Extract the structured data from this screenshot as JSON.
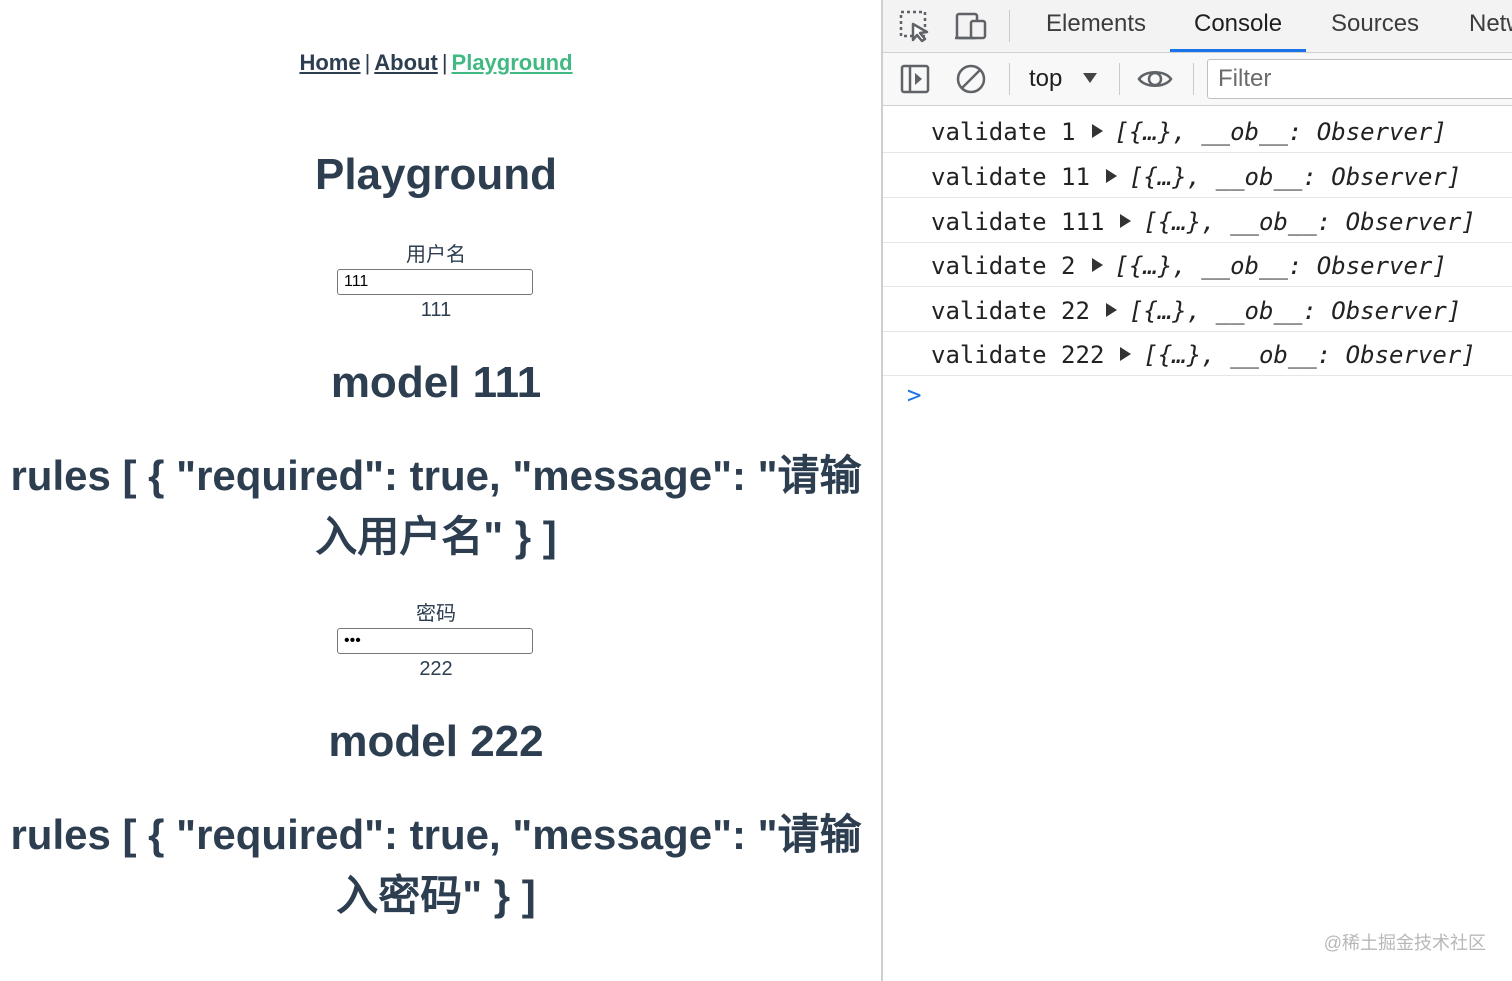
{
  "app": {
    "nav": [
      {
        "label": "Home"
      },
      {
        "label": "About"
      },
      {
        "label": "Playground"
      }
    ],
    "nav_separator": "|",
    "title": "Playground",
    "username": {
      "label": "用户名",
      "value": "111",
      "echo": "111",
      "model": "model 111",
      "rules": "rules [ { \"required\": true, \"message\": \"请输入用户名\" } ]"
    },
    "password": {
      "label": "密码",
      "value": "222",
      "echo": "222",
      "model": "model 222",
      "rules": "rules [ { \"required\": true, \"message\": \"请输入密码\" } ]"
    }
  },
  "devtools": {
    "tabs": [
      "Elements",
      "Console",
      "Sources",
      "Network"
    ],
    "active_tab": "Console",
    "context": "top",
    "filter_placeholder": "Filter",
    "logs": [
      {
        "text": "validate 1",
        "object": "[{…}, __ob__: Observer]"
      },
      {
        "text": "validate 11",
        "object": "[{…}, __ob__: Observer]"
      },
      {
        "text": "validate 111",
        "object": "[{…}, __ob__: Observer]"
      },
      {
        "text": "validate 2",
        "object": "[{…}, __ob__: Observer]"
      },
      {
        "text": "validate 22",
        "object": "[{…}, __ob__: Observer]"
      },
      {
        "text": "validate 222",
        "object": "[{…}, __ob__: Observer]"
      }
    ],
    "prompt_symbol": ">",
    "accent_color": "#1a73e8"
  },
  "watermark": "@稀土掘金技术社区",
  "colors": {
    "text": "#2c3e50",
    "active_link": "#42b983"
  }
}
